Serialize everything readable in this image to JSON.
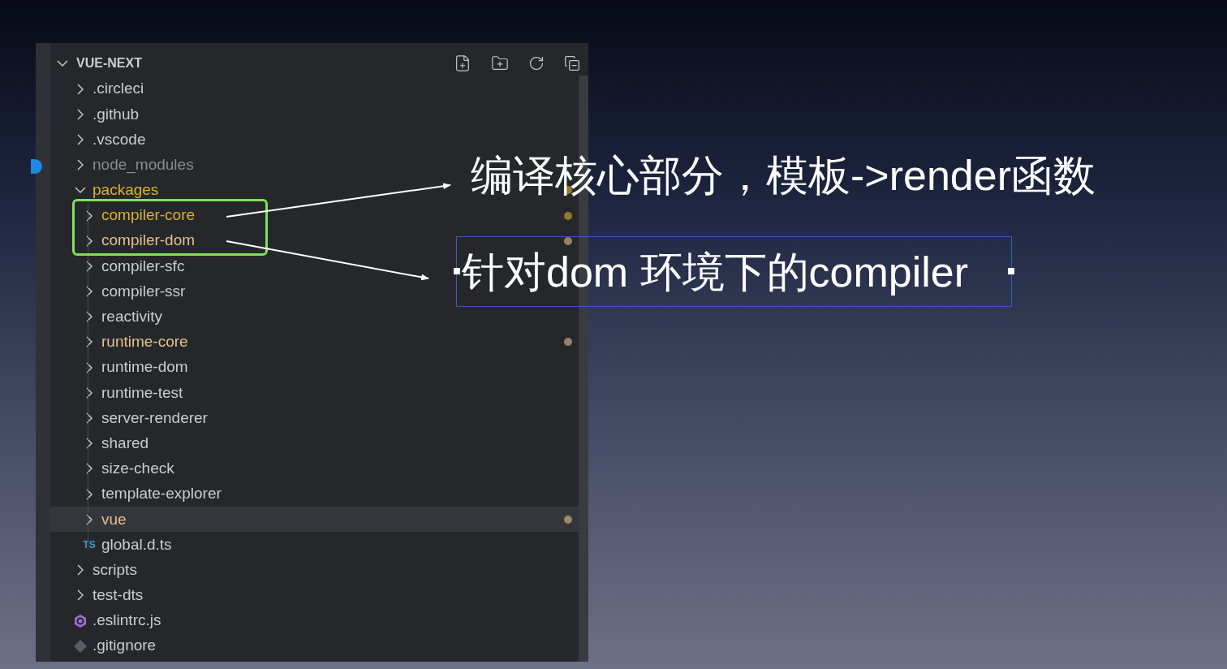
{
  "explorer": {
    "title": "VUE-NEXT",
    "expanded": true,
    "items": [
      {
        "name": ".circleci",
        "kind": "folder",
        "expanded": false,
        "color": "#cccccc",
        "dot": false,
        "selected": false
      },
      {
        "name": ".github",
        "kind": "folder",
        "expanded": false,
        "color": "#cccccc",
        "dot": false,
        "selected": false
      },
      {
        "name": ".vscode",
        "kind": "folder",
        "expanded": false,
        "color": "#cccccc",
        "dot": false,
        "selected": false
      },
      {
        "name": "node_modules",
        "kind": "folder",
        "expanded": false,
        "color": "#8c8c8c",
        "dot": false,
        "selected": false
      },
      {
        "name": "packages",
        "kind": "folder",
        "expanded": true,
        "color": "#d9b32a",
        "dot": true,
        "selected": false,
        "children": [
          {
            "name": "compiler-core",
            "kind": "folder",
            "expanded": false,
            "color": "#d9b32a",
            "dot": true,
            "selected": false
          },
          {
            "name": "compiler-dom",
            "kind": "folder",
            "expanded": false,
            "color": "#e2c08d",
            "dot": true,
            "selected": false
          },
          {
            "name": "compiler-sfc",
            "kind": "folder",
            "expanded": false,
            "color": "#cccccc",
            "dot": false,
            "selected": false
          },
          {
            "name": "compiler-ssr",
            "kind": "folder",
            "expanded": false,
            "color": "#cccccc",
            "dot": false,
            "selected": false
          },
          {
            "name": "reactivity",
            "kind": "folder",
            "expanded": false,
            "color": "#cccccc",
            "dot": false,
            "selected": false
          },
          {
            "name": "runtime-core",
            "kind": "folder",
            "expanded": false,
            "color": "#e2c08d",
            "dot": true,
            "selected": false
          },
          {
            "name": "runtime-dom",
            "kind": "folder",
            "expanded": false,
            "color": "#cccccc",
            "dot": false,
            "selected": false
          },
          {
            "name": "runtime-test",
            "kind": "folder",
            "expanded": false,
            "color": "#cccccc",
            "dot": false,
            "selected": false
          },
          {
            "name": "server-renderer",
            "kind": "folder",
            "expanded": false,
            "color": "#cccccc",
            "dot": false,
            "selected": false
          },
          {
            "name": "shared",
            "kind": "folder",
            "expanded": false,
            "color": "#cccccc",
            "dot": false,
            "selected": false
          },
          {
            "name": "size-check",
            "kind": "folder",
            "expanded": false,
            "color": "#cccccc",
            "dot": false,
            "selected": false
          },
          {
            "name": "template-explorer",
            "kind": "folder",
            "expanded": false,
            "color": "#cccccc",
            "dot": false,
            "selected": false
          },
          {
            "name": "vue",
            "kind": "folder",
            "expanded": false,
            "color": "#e2c08d",
            "dot": true,
            "selected": true
          },
          {
            "name": "global.d.ts",
            "kind": "ts",
            "badge": "TS",
            "color": "#cccccc",
            "dot": false,
            "selected": false
          }
        ]
      },
      {
        "name": "scripts",
        "kind": "folder",
        "expanded": false,
        "color": "#cccccc",
        "dot": false,
        "selected": false
      },
      {
        "name": "test-dts",
        "kind": "folder",
        "expanded": false,
        "color": "#cccccc",
        "dot": false,
        "selected": false
      },
      {
        "name": ".eslintrc.js",
        "kind": "eslint",
        "color": "#cccccc",
        "dot": false,
        "selected": false
      },
      {
        "name": ".gitignore",
        "kind": "git",
        "color": "#cccccc",
        "dot": false,
        "selected": false
      }
    ]
  },
  "annotations": [
    {
      "text": "编译核心部分，模板->render函数",
      "boxed": false
    },
    {
      "text": "针对dom 环境下的compiler",
      "boxed": true
    }
  ]
}
